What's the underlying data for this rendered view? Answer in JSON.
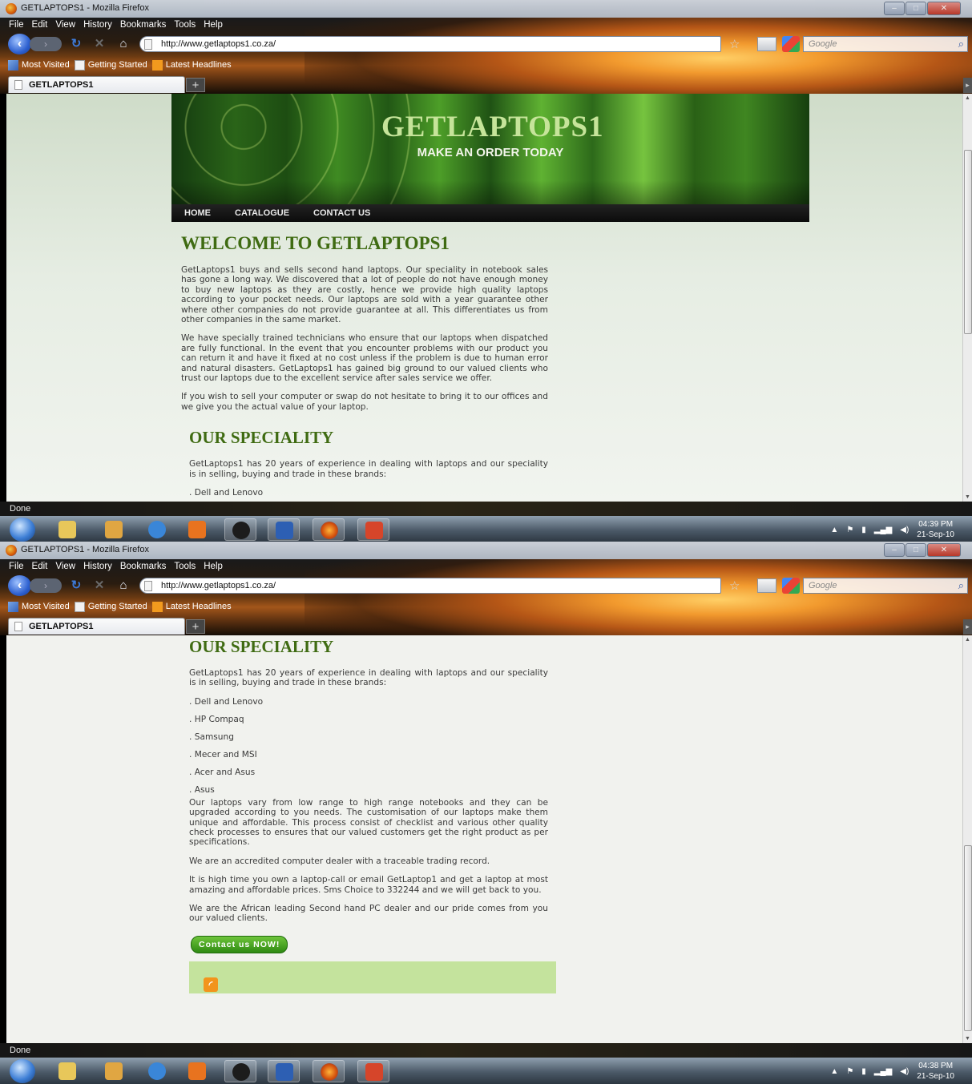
{
  "window": {
    "title": "GETLAPTOPS1 - Mozilla Firefox",
    "buttons": [
      "–",
      "□",
      "✕"
    ]
  },
  "menu": [
    "File",
    "Edit",
    "View",
    "History",
    "Bookmarks",
    "Tools",
    "Help"
  ],
  "nav": {
    "url": "http://www.getlaptops1.co.za/",
    "search_placeholder": "Google"
  },
  "bookmarks": [
    "Most Visited",
    "Getting Started",
    "Latest Headlines"
  ],
  "tab": {
    "label": "GETLAPTOPS1",
    "new_tab": "+"
  },
  "status_text": "Done",
  "clock": [
    {
      "time": "04:39 PM",
      "date": "21-Sep-10"
    },
    {
      "time": "04:38 PM",
      "date": "21-Sep-10"
    }
  ],
  "site": {
    "title": "GETLAPTOPS1",
    "slogan": "MAKE AN ORDER TODAY",
    "nav": [
      "HOME",
      "CATALOGUE",
      "CONTACT US"
    ],
    "welcome_heading": "WELCOME TO GETLAPTOPS1",
    "welcome_p1": "GetLaptops1 buys and sells second hand laptops. Our speciality in notebook sales has gone a long way. We discovered that a lot of people do not have enough money to buy new laptops as they are costly, hence we provide high quality laptops according to your pocket needs. Our laptops are sold with a year guarantee other where other companies do not provide guarantee at all. This differentiates us from other companies in the same market.",
    "welcome_p2": "We have specially trained technicians who ensure that our laptops when dispatched are fully functional. In the event that you encounter problems with our product you can return it and have it fixed at no cost unless if the problem is due to human error and natural disasters. GetLaptops1 has gained big ground to our valued clients who trust our laptops due to the excellent service after sales service we offer.",
    "welcome_p3": "If you wish to sell your computer or swap do not hesitate to bring it to our offices and we give you the actual value of your laptop.",
    "speciality_heading": "OUR SPECIALITY",
    "speciality_intro": "GetLaptops1 has 20 years of experience in dealing with laptops and our speciality is in selling, buying and trade in these brands:",
    "brands": [
      ". Dell and Lenovo",
      ". HP Compaq",
      ". Samsung",
      ". Mecer and MSI",
      ". Acer and Asus",
      ". Asus"
    ],
    "p_range": "Our laptops vary from low range to high range notebooks and they can be upgraded according to you needs. The customisation of our laptops make them unique and affordable. This process consist of checklist and various other quality check processes to ensures that our valued customers get the right product as per specifications.",
    "p_dealer": "We are an accredited computer dealer with a traceable trading record.",
    "p_time": "It is high time you own a laptop-call or email GetLaptop1 and get a laptop at most amazing and affordable prices. Sms Choice to 332244 and we will get back to you.",
    "p_african": "We are the African leading Second hand PC dealer and our pride comes from you our valued clients.",
    "cta": "Contact us NOW!"
  }
}
